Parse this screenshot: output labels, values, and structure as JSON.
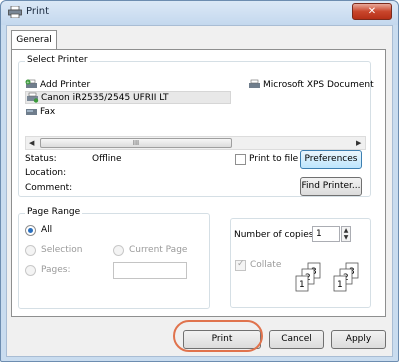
{
  "window": {
    "title": "Print",
    "close_label": "✕"
  },
  "tabs": [
    {
      "label": "General"
    }
  ],
  "select_printer": {
    "legend": "Select Printer",
    "printers": [
      {
        "name": "Add Printer",
        "icon": "add-printer-icon"
      },
      {
        "name": "Canon iR2535/2545 UFRII LT",
        "icon": "printer-icon",
        "selected": true
      },
      {
        "name": "Fax",
        "icon": "fax-icon"
      },
      {
        "name": "Microsoft XPS Document",
        "icon": "printer-icon"
      }
    ],
    "scrollbar_thumb_label": "III",
    "status_label": "Status:",
    "status_value": "Offline",
    "location_label": "Location:",
    "comment_label": "Comment:",
    "print_to_file_label": "Print to file",
    "preferences_label": "Preferences",
    "find_printer_label": "Find Printer..."
  },
  "page_range": {
    "legend": "Page Range",
    "options": {
      "all": "All",
      "selection": "Selection",
      "current_page": "Current Page",
      "pages": "Pages:"
    },
    "selected": "all"
  },
  "copies": {
    "label": "Number of copies:",
    "value": "1",
    "collate_label": "Collate",
    "collate_checked": true
  },
  "footer": {
    "print_label": "Print",
    "cancel_label": "Cancel",
    "apply_label": "Apply"
  },
  "colors": {
    "accent": "#3c7fb1",
    "highlight_ring": "#e0734d",
    "close_button": "#c9462c"
  }
}
